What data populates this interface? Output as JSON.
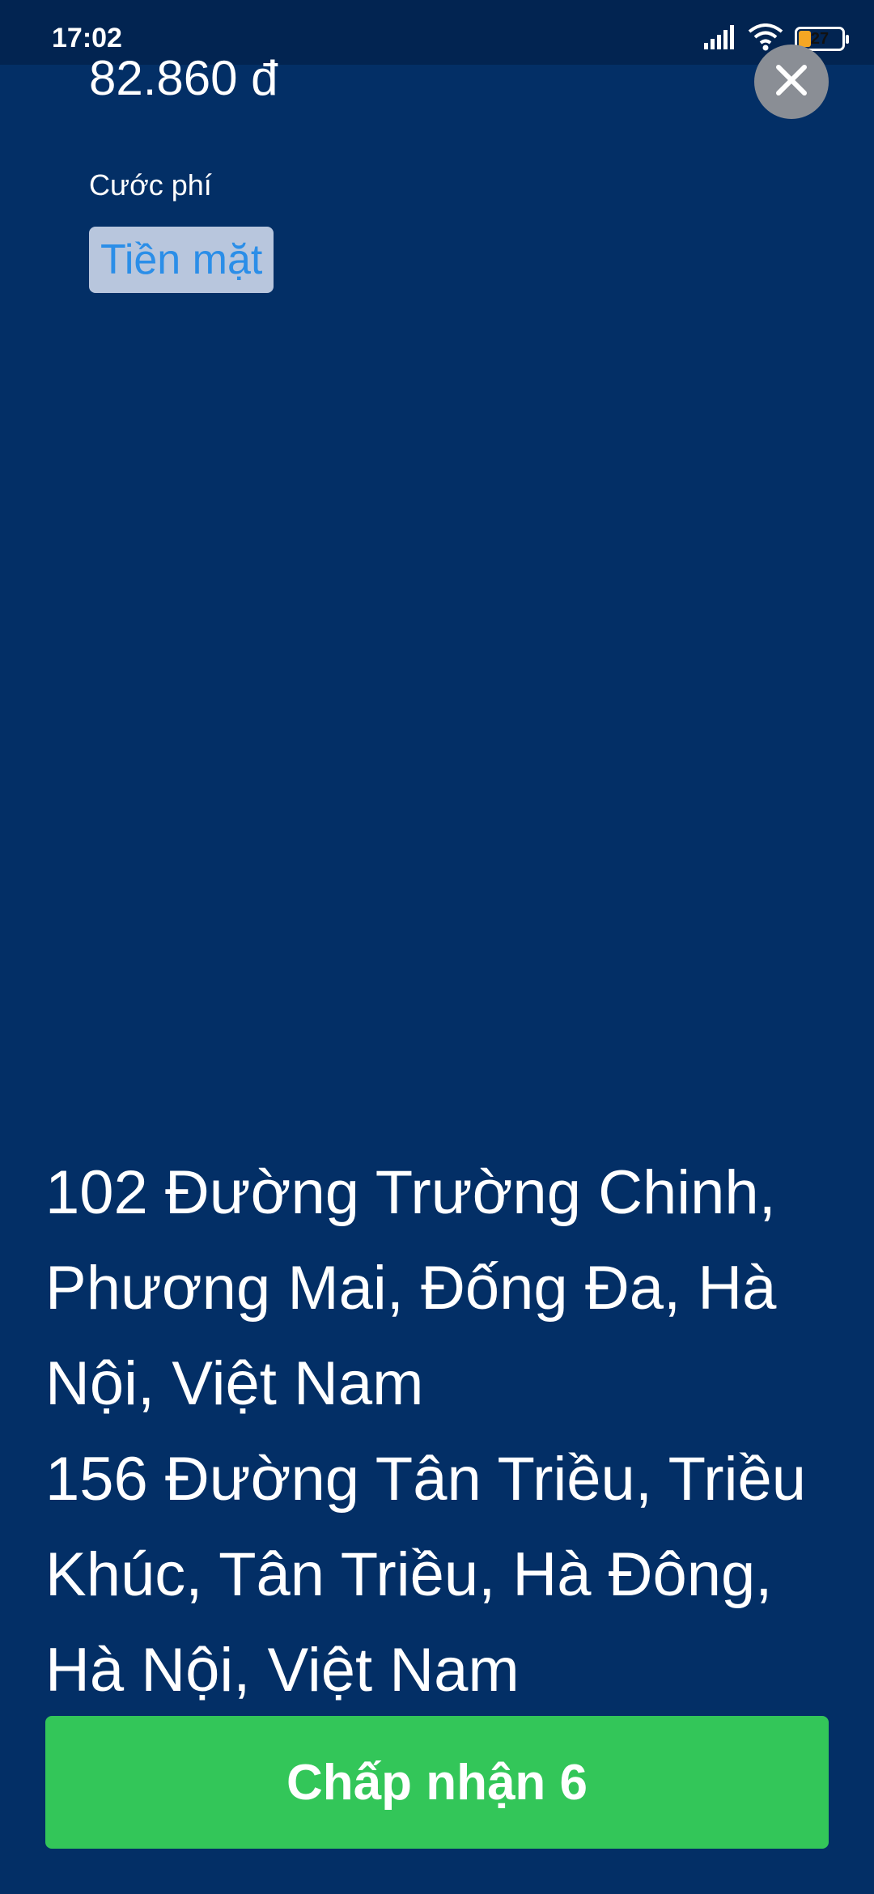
{
  "status_bar": {
    "time": "17:02",
    "battery_level": "27"
  },
  "order": {
    "price": "82.860 đ",
    "fee_label": "Cước phí",
    "payment_method": "Tiền mặt"
  },
  "addresses": [
    "102 Đường Trường Chinh, Phương Mai, Đống Đa, Hà Nội, Việt Nam",
    "156 Đường Tân Triều, Triều Khúc, Tân Triều, Hà Đông, Hà Nội, Việt Nam"
  ],
  "actions": {
    "accept_label": "Chấp nhận 6"
  },
  "colors": {
    "background": "#032f66",
    "accept_button": "#33c659",
    "payment_badge_bg": "#b8c6dd",
    "payment_badge_text": "#2b8ee8"
  },
  "icons": {
    "close": "close-icon",
    "signal": "signal-icon",
    "wifi": "wifi-icon",
    "battery": "battery-icon"
  }
}
